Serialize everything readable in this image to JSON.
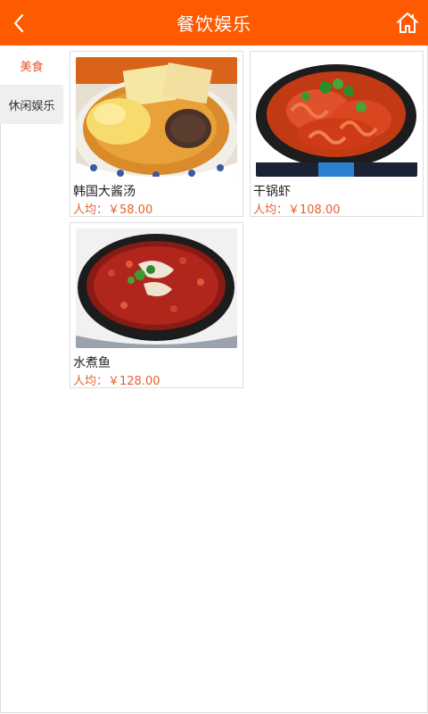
{
  "header": {
    "title": "餐饮娱乐",
    "back_icon": "chevron-left-icon",
    "home_icon": "home-icon"
  },
  "sidebar": {
    "items": [
      {
        "label": "美食",
        "active": true
      },
      {
        "label": "休闲娱乐",
        "active": false
      }
    ]
  },
  "products": [
    {
      "name": "韩国大酱汤",
      "price": "人均：￥58.00"
    },
    {
      "name": "干锅虾",
      "price": "人均：￥108.00"
    },
    {
      "name": "水煮鱼",
      "price": "人均：￥128.00"
    }
  ],
  "colors": {
    "brand": "#fe5a02",
    "price": "#e5612f",
    "active_tab": "#e8502a"
  }
}
